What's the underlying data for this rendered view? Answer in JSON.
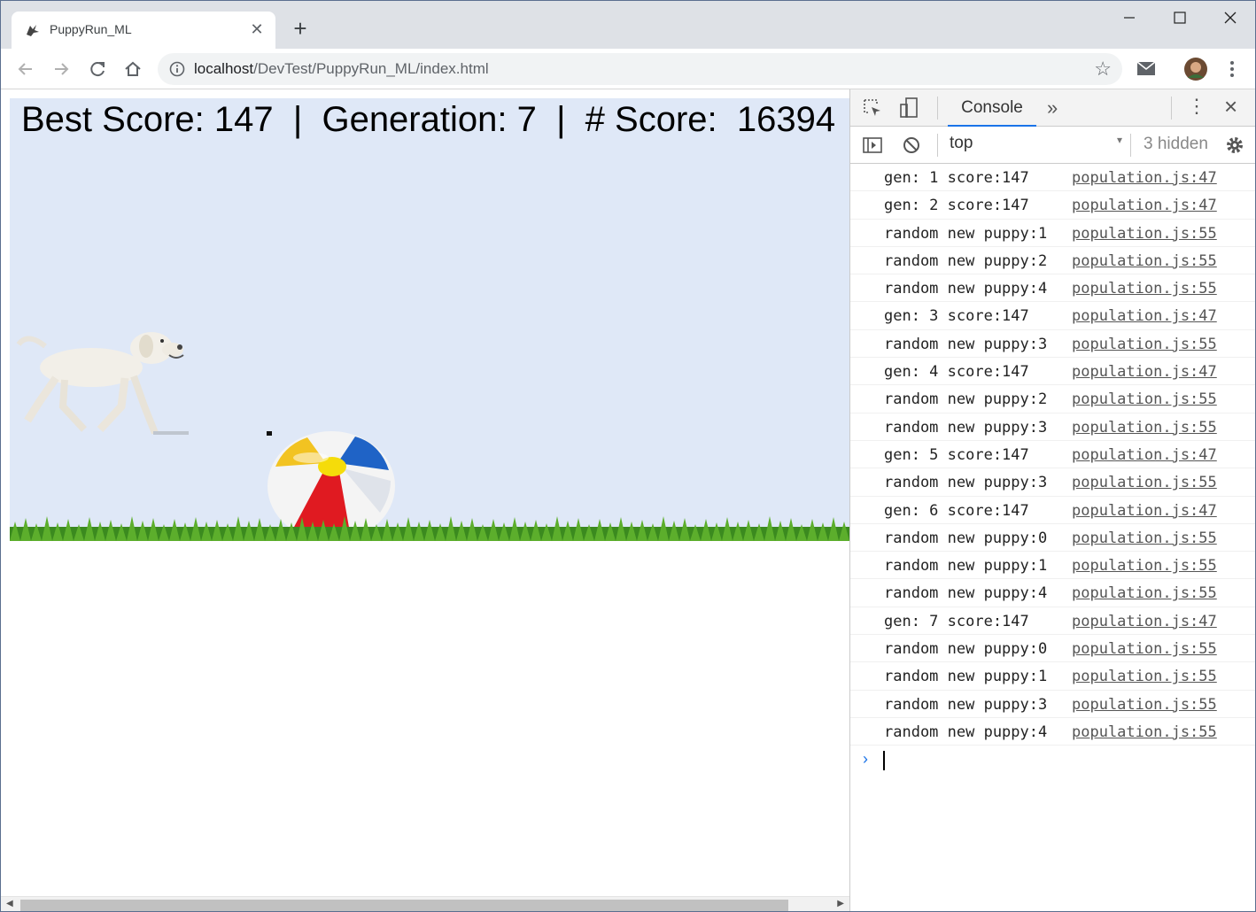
{
  "browser": {
    "tab_title": "PuppyRun_ML",
    "new_tab_symbol": "+",
    "url_host": "localhost",
    "url_path": "/DevTest/PuppyRun_ML/index.html"
  },
  "game": {
    "score_line": "Best Score: 147  |  Generation: 7  |  # Score:  16394"
  },
  "devtools": {
    "console_tab": "Console",
    "context": "top",
    "hidden_label": "3 hidden",
    "logs": [
      {
        "msg": "gen: 1 score:147",
        "src": "population.js:47"
      },
      {
        "msg": "gen: 2 score:147",
        "src": "population.js:47"
      },
      {
        "msg": "random new puppy:1",
        "src": "population.js:55"
      },
      {
        "msg": "random new puppy:2",
        "src": "population.js:55"
      },
      {
        "msg": "random new puppy:4",
        "src": "population.js:55"
      },
      {
        "msg": "gen: 3 score:147",
        "src": "population.js:47"
      },
      {
        "msg": "random new puppy:3",
        "src": "population.js:55"
      },
      {
        "msg": "gen: 4 score:147",
        "src": "population.js:47"
      },
      {
        "msg": "random new puppy:2",
        "src": "population.js:55"
      },
      {
        "msg": "random new puppy:3",
        "src": "population.js:55"
      },
      {
        "msg": "gen: 5 score:147",
        "src": "population.js:47"
      },
      {
        "msg": "random new puppy:3",
        "src": "population.js:55"
      },
      {
        "msg": "gen: 6 score:147",
        "src": "population.js:47"
      },
      {
        "msg": "random new puppy:0",
        "src": "population.js:55"
      },
      {
        "msg": "random new puppy:1",
        "src": "population.js:55"
      },
      {
        "msg": "random new puppy:4",
        "src": "population.js:55"
      },
      {
        "msg": "gen: 7 score:147",
        "src": "population.js:47"
      },
      {
        "msg": "random new puppy:0",
        "src": "population.js:55"
      },
      {
        "msg": "random new puppy:1",
        "src": "population.js:55"
      },
      {
        "msg": "random new puppy:3",
        "src": "population.js:55"
      },
      {
        "msg": "random new puppy:4",
        "src": "population.js:55"
      }
    ]
  }
}
